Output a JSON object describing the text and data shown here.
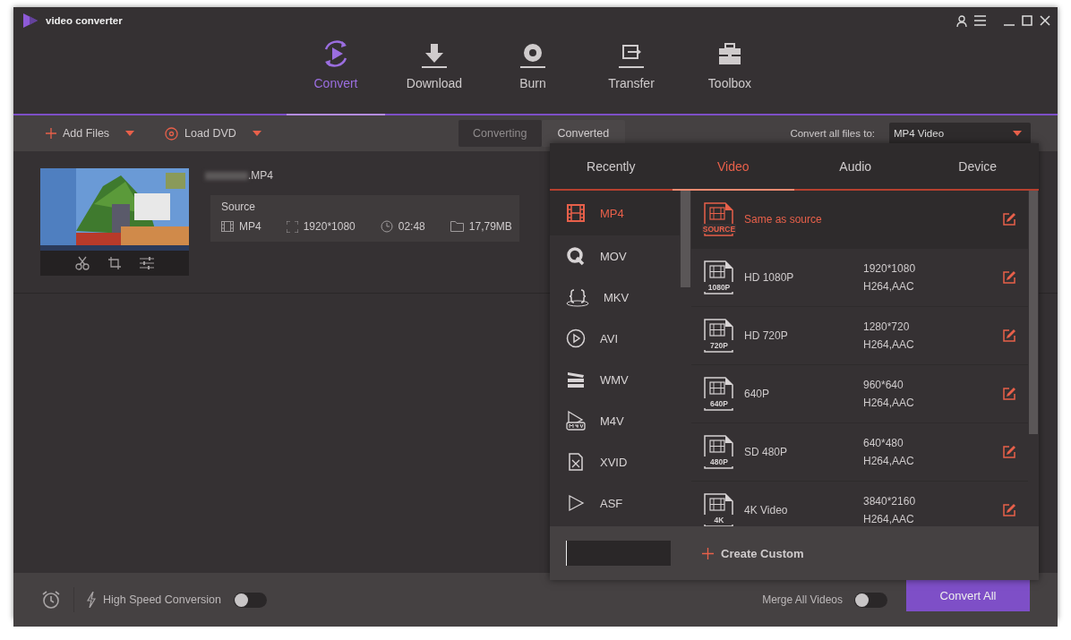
{
  "window": {
    "title": "video converter"
  },
  "nav": [
    {
      "label": "Convert",
      "kind": "convert",
      "selected": true
    },
    {
      "label": "Download",
      "kind": "download",
      "selected": false
    },
    {
      "label": "Burn",
      "kind": "burn",
      "selected": false
    },
    {
      "label": "Transfer",
      "kind": "transfer",
      "selected": false
    },
    {
      "label": "Toolbox",
      "kind": "toolbox",
      "selected": false
    }
  ],
  "toolbar": {
    "add_files": "Add Files",
    "load_dvd": "Load DVD",
    "tabs": [
      {
        "label": "Converting",
        "selected": true
      },
      {
        "label": "Converted",
        "selected": false
      }
    ],
    "convert_all_label": "Convert all files to:",
    "convert_all_value": "MP4 Video"
  },
  "file": {
    "name": ".MP4",
    "source_label": "Source",
    "format": "MP4",
    "resolution": "1920*1080",
    "duration": "02:48",
    "size": "17,79MB"
  },
  "format_panel": {
    "tabs": [
      {
        "label": "Recently",
        "selected": false
      },
      {
        "label": "Video",
        "selected": true
      },
      {
        "label": "Audio",
        "selected": false
      },
      {
        "label": "Device",
        "selected": false
      }
    ],
    "formats": [
      {
        "label": "MP4",
        "kind": "film",
        "selected": true
      },
      {
        "label": "MOV",
        "kind": "q",
        "selected": false
      },
      {
        "label": "MKV",
        "kind": "braces",
        "selected": false
      },
      {
        "label": "AVI",
        "kind": "play",
        "selected": false
      },
      {
        "label": "WMV",
        "kind": "clapper",
        "selected": false
      },
      {
        "label": "M4V",
        "kind": "m4v",
        "selected": false
      },
      {
        "label": "XVID",
        "kind": "xfile",
        "selected": false
      },
      {
        "label": "ASF",
        "kind": "triangle",
        "selected": false
      }
    ],
    "presets": [
      {
        "name": "Same as source",
        "badge": "SOURCE",
        "selected": true
      },
      {
        "name": "HD 1080P",
        "badge": "1080P",
        "resolution": "1920*1080",
        "codec": "H264,AAC",
        "selected": false
      },
      {
        "name": "HD 720P",
        "badge": "720P",
        "resolution": "1280*720",
        "codec": "H264,AAC",
        "selected": false
      },
      {
        "name": "640P",
        "badge": "640P",
        "resolution": "960*640",
        "codec": "H264,AAC",
        "selected": false
      },
      {
        "name": "SD 480P",
        "badge": "480P",
        "resolution": "640*480",
        "codec": "H264,AAC",
        "selected": false
      },
      {
        "name": "4K Video",
        "badge": "4K",
        "resolution": "3840*2160",
        "codec": "H264,AAC",
        "selected": false
      }
    ],
    "create_custom": "Create Custom"
  },
  "footer": {
    "high_speed_label": "High Speed Conversion",
    "high_speed_on": false,
    "merge_label": "Merge All Videos",
    "merge_on": false,
    "convert_all": "Convert All"
  }
}
